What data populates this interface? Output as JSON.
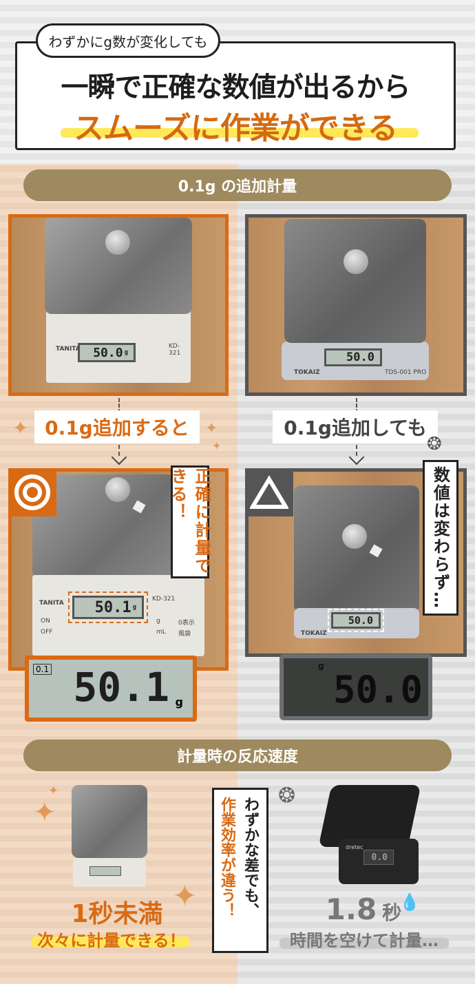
{
  "header": {
    "bubble": "わずかにg数が変化しても",
    "line1": "一瞬で正確な数値が出るから",
    "line2": "スムーズに作業ができる"
  },
  "section1": {
    "title": "0.1g の追加計量"
  },
  "left": {
    "brand": "TANITA",
    "model": "KD-321",
    "before_display": "50.0",
    "before_unit": "g",
    "label_on": "ON",
    "label_off": "OFF",
    "label_gml": "g",
    "label_ml": "mL",
    "label_zero": "0表示",
    "label_tare": "風袋",
    "caption": "0.1g追加すると",
    "rating_icon": "double-circle-icon",
    "note": "正確に計量できる！",
    "after_display": "50.1",
    "after_unit": "g",
    "zoom_display": "50.1",
    "zoom_unit": "g",
    "zoom_tag": "0.1",
    "accent": "#d96a14"
  },
  "right": {
    "brand": "TOKAIZ",
    "model": "TDS-001 PRO",
    "before_display": "50.0",
    "caption": "0.1g追加しても",
    "rating_icon": "triangle-icon",
    "note": "数値は変わらず…",
    "after_display": "50.0",
    "zoom_display": "50.0",
    "zoom_unit": "g"
  },
  "section2": {
    "title": "計量時の反応速度"
  },
  "speed": {
    "left_time": "1秒未満",
    "left_sub": "次々に計量できる！",
    "center_note_a": "わずかな差でも、",
    "center_note_b": "作業効率が違う！",
    "right_time": "1.8",
    "right_unit": "秒",
    "right_sub": "時間を空けて計量…",
    "right_scale_display": "0.0",
    "right_scale_brand": "dretec"
  }
}
